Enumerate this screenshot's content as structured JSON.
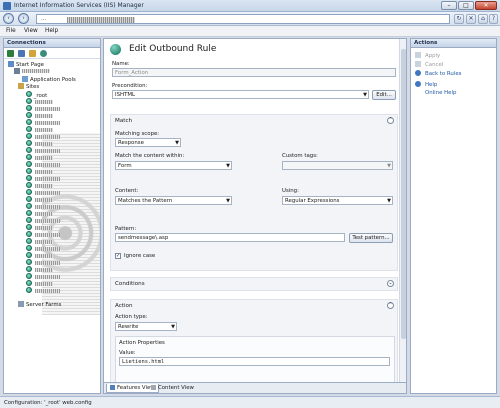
{
  "window": {
    "title": "Internet Information Services (IIS) Manager"
  },
  "address": {
    "segment": "…"
  },
  "menu": [
    "File",
    "View",
    "Help"
  ],
  "connections": {
    "header": "Connections",
    "tree": {
      "start_page": "Start Page",
      "app_pools": "Application Pools",
      "sites": "Sites",
      "root_site": "_root",
      "server_farms": "Server Farms"
    }
  },
  "editor": {
    "title": "Edit Outbound Rule",
    "name_label": "Name:",
    "name_value": "Form_Action",
    "precondition_label": "Precondition:",
    "precondition_value": "ISHTML",
    "edit_button": "Edit...",
    "match": {
      "header": "Match",
      "scope_label": "Matching scope:",
      "scope_value": "Response",
      "within_label": "Match the content within:",
      "within_value": "Form",
      "custom_tags_label": "Custom tags:",
      "content_label": "Content:",
      "content_value": "Matches the Pattern",
      "using_label": "Using:",
      "using_value": "Regular Expressions",
      "pattern_label": "Pattern:",
      "pattern_value": "sendmessage\\.asp",
      "test_button": "Test pattern...",
      "ignore_case_label": "Ignore case",
      "ignore_case_checked": true
    },
    "conditions": {
      "header": "Conditions"
    },
    "action": {
      "header": "Action",
      "type_label": "Action type:",
      "type_value": "Rewrite",
      "properties_label": "Action Properties",
      "value_label": "Value:",
      "value_value": "Lietiens.html"
    }
  },
  "bottom_tabs": {
    "features": "Features View",
    "content": "Content View"
  },
  "actions": {
    "header": "Actions",
    "apply": "Apply",
    "cancel": "Cancel",
    "back": "Back to Rules",
    "help": "Help",
    "online_help": "Online Help"
  },
  "status": {
    "text": "Configuration: '_root' web.config"
  },
  "colors": {
    "accent": "#1d58a8",
    "panel_border": "#9aabc3"
  }
}
